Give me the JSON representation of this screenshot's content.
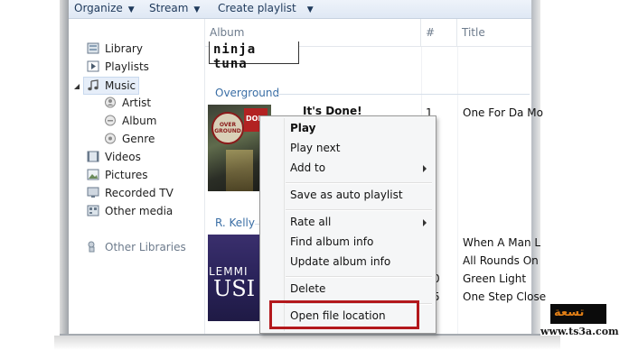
{
  "toolbar": {
    "organize": "Organize",
    "stream": "Stream",
    "create_playlist": "Create playlist"
  },
  "nav": {
    "items": [
      {
        "label": "Library",
        "icon": "library-icon"
      },
      {
        "label": "Playlists",
        "icon": "playlist-icon"
      },
      {
        "label": "Music",
        "icon": "music-note-icon"
      },
      {
        "label": "Artist",
        "icon": "artist-icon"
      },
      {
        "label": "Album",
        "icon": "album-icon"
      },
      {
        "label": "Genre",
        "icon": "genre-icon"
      },
      {
        "label": "Videos",
        "icon": "video-icon"
      },
      {
        "label": "Pictures",
        "icon": "picture-icon"
      },
      {
        "label": "Recorded TV",
        "icon": "tv-icon"
      },
      {
        "label": "Other media",
        "icon": "other-media-icon"
      },
      {
        "label": "Other Libraries",
        "icon": "other-libraries-icon"
      }
    ]
  },
  "columns": [
    "Album",
    "#",
    "Title"
  ],
  "albums": [
    {
      "art_text": "ninja tuna"
    },
    {
      "group": "Overground",
      "song": "It's Done!",
      "number": "1",
      "title": "One For Da Mo",
      "art_badge": "OVER GROUND",
      "art_sign": "DONE"
    },
    {
      "group": "R. Kelly",
      "art_text_1": "LEMMI",
      "art_text_2": "USI"
    }
  ],
  "rkelly_rows": [
    {
      "number": "",
      "title": "When A Man L"
    },
    {
      "number": "",
      "title": "All Rounds On"
    },
    {
      "number": "0",
      "title": "Green Light"
    },
    {
      "number": "5",
      "title": "One Step Close"
    }
  ],
  "context_menu": {
    "items": [
      "Play",
      "Play next",
      "Add to",
      "Save as auto playlist",
      "Rate all",
      "Find album info",
      "Update album info",
      "Delete",
      "Open file location"
    ]
  },
  "watermark": {
    "logo": "تسعة",
    "url": "www.ts3a.com"
  },
  "colors": {
    "highlight": "#b3181c",
    "group_header": "#3a6ea5"
  }
}
